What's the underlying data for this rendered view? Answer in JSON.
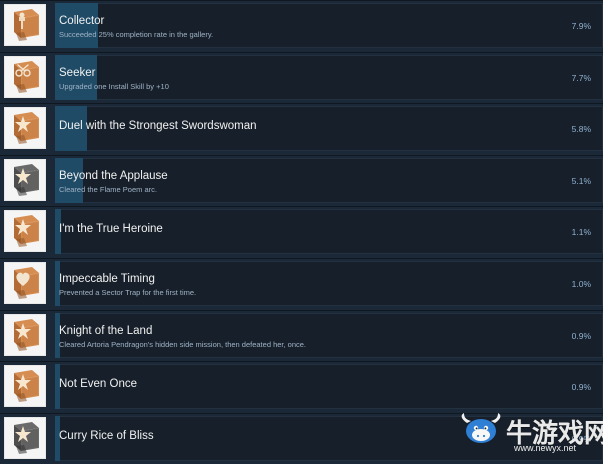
{
  "achievements": [
    {
      "title": "Collector",
      "description": "Succeeded 25% completion rate in the gallery.",
      "percent": "7.9%",
      "progress": 7.9,
      "icon": "bronze-box-key-icon",
      "icon_style": "bronze"
    },
    {
      "title": "Seeker",
      "description": "Upgraded one Install Skill by +10",
      "percent": "7.7%",
      "progress": 7.7,
      "icon": "bronze-box-scissors-icon",
      "icon_style": "bronze"
    },
    {
      "title": "Duel with the Strongest Swordswoman",
      "description": "",
      "percent": "5.8%",
      "progress": 5.8,
      "icon": "bronze-box-star-icon",
      "icon_style": "bronze"
    },
    {
      "title": "Beyond the Applause",
      "description": "Cleared the Flame Poem arc.",
      "percent": "5.1%",
      "progress": 5.1,
      "icon": "grey-box-star-icon",
      "icon_style": "grey"
    },
    {
      "title": "I'm the True Heroine",
      "description": "",
      "percent": "1.1%",
      "progress": 1.1,
      "icon": "bronze-box-star-icon",
      "icon_style": "bronze"
    },
    {
      "title": "Impeccable Timing",
      "description": "Prevented a Sector Trap for the first time.",
      "percent": "1.0%",
      "progress": 1.0,
      "icon": "bronze-box-heart-icon",
      "icon_style": "bronze"
    },
    {
      "title": "Knight of the Land",
      "description": "Cleared Artoria Pendragon's hidden side mission, then defeated her, once.",
      "percent": "0.9%",
      "progress": 0.9,
      "icon": "bronze-box-star-icon",
      "icon_style": "bronze"
    },
    {
      "title": "Not Even Once",
      "description": "",
      "percent": "0.9%",
      "progress": 0.9,
      "icon": "bronze-box-star-icon",
      "icon_style": "bronze"
    },
    {
      "title": "Curry Rice of Bliss",
      "description": "",
      "percent": "0.9%",
      "progress": 0.9,
      "icon": "grey-box-star-icon",
      "icon_style": "grey"
    }
  ],
  "watermark": {
    "text": "牛游戏网",
    "url": "www.newyx.net"
  },
  "colors": {
    "background": "#1b2838",
    "panel": "#17202a",
    "progress_fill": "#1f4b66",
    "title_text": "#f1f1f1",
    "description_text": "#9fb2c6",
    "percent_text": "#8fb1d1",
    "bronze": "#c87a43",
    "grey": "#5a5a5a"
  }
}
